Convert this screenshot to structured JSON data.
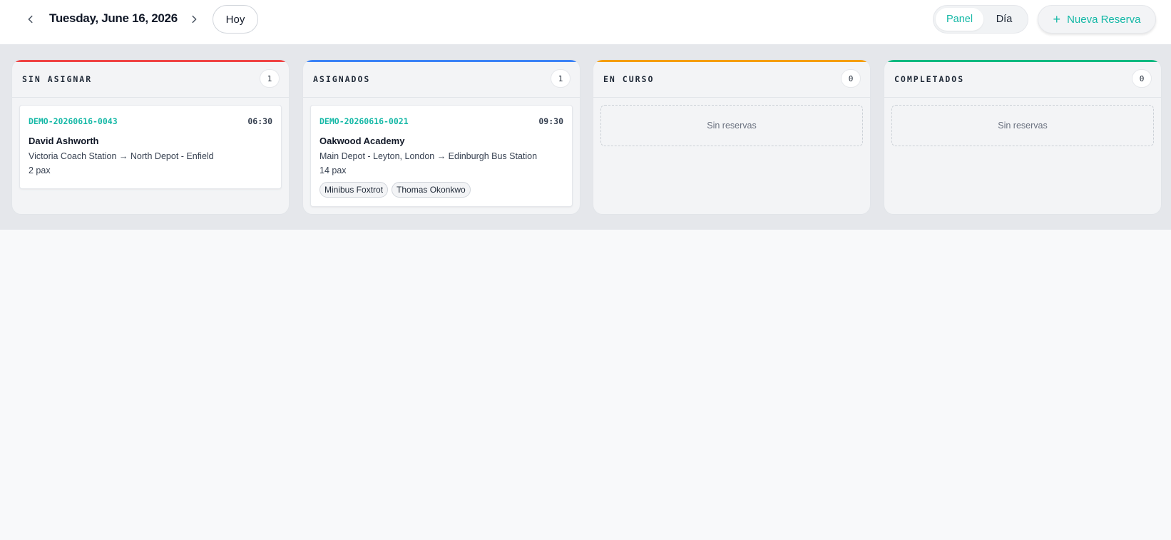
{
  "header": {
    "date_title": "Tuesday, June 16, 2026",
    "today_label": "Hoy",
    "view_toggle": {
      "panel_label": "Panel",
      "day_label": "Día",
      "active": "Panel"
    },
    "new_booking_label": "Nueva Reserva",
    "icons": {
      "prev": "chevron-left-icon",
      "next": "chevron-right-icon",
      "add": "plus-icon"
    }
  },
  "columns": [
    {
      "title": "SIN ASIGNAR",
      "count": "1",
      "accent": "#ef4444",
      "cards": [
        {
          "id": "DEMO-20260616-0043",
          "time": "06:30",
          "name": "David Ashworth",
          "route": "Victoria Coach Station → North Depot - Enfield",
          "pax": "2 pax"
        }
      ]
    },
    {
      "title": "ASIGNADOS",
      "count": "1",
      "accent": "#3b82f6",
      "cards": [
        {
          "id": "DEMO-20260616-0021",
          "time": "09:30",
          "name": "Oakwood Academy",
          "route": "Main Depot - Leyton, London → Edinburgh Bus Station",
          "pax": "14 pax",
          "tags": [
            "Minibus Foxtrot",
            "Thomas Okonkwo"
          ]
        }
      ]
    },
    {
      "title": "EN CURSO",
      "count": "0",
      "accent": "#f59e0b",
      "empty_label": "Sin reservas"
    },
    {
      "title": "COMPLETADOS",
      "count": "0",
      "accent": "#10b981",
      "empty_label": "Sin reservas"
    }
  ],
  "colors": {
    "brand": "#14b8a6"
  }
}
